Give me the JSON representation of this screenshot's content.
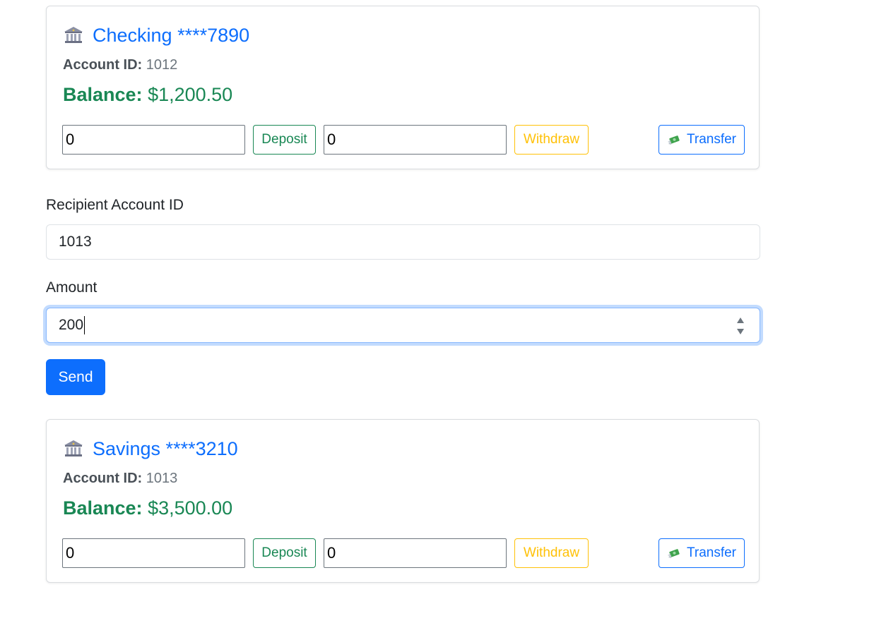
{
  "accounts": [
    {
      "title": "Checking ****7890",
      "account_id_label": "Account ID:",
      "account_id": "1012",
      "balance_label": "Balance:",
      "balance": "$1,200.50",
      "deposit_value": "0",
      "withdraw_value": "0",
      "deposit_label": "Deposit",
      "withdraw_label": "Withdraw",
      "transfer_label": "Transfer"
    },
    {
      "title": "Savings ****3210",
      "account_id_label": "Account ID:",
      "account_id": "1013",
      "balance_label": "Balance:",
      "balance": "$3,500.00",
      "deposit_value": "0",
      "withdraw_value": "0",
      "deposit_label": "Deposit",
      "withdraw_label": "Withdraw",
      "transfer_label": "Transfer"
    }
  ],
  "transfer_form": {
    "recipient_label": "Recipient Account ID",
    "recipient_value": "1013",
    "amount_label": "Amount",
    "amount_value": "200",
    "send_label": "Send"
  },
  "icons": {
    "account": "bank-icon",
    "transfer": "money-with-wings-icon",
    "stepper": "number-stepper-icon"
  },
  "colors": {
    "primary": "#0d6efd",
    "success": "#198754",
    "warning": "#ffc107",
    "muted": "#6c757d"
  }
}
